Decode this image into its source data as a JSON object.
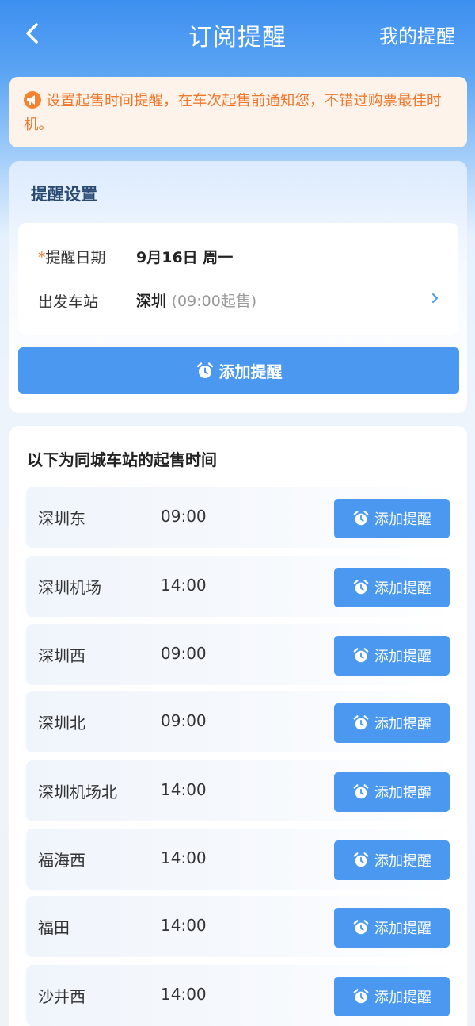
{
  "header": {
    "title": "订阅提醒",
    "right_link": "我的提醒",
    "back_icon": "chevron-left-icon"
  },
  "notice": {
    "icon": "megaphone-icon",
    "text": "设置起售时间提醒，在车次起售前通知您，不错过购票最佳时机。"
  },
  "settings": {
    "title": "提醒设置",
    "date_label": "提醒日期",
    "required_mark": "*",
    "date_value": "9月16日 周一",
    "station_label": "出发车站",
    "station_value": "深圳",
    "station_sale_time": "(09:00起售)",
    "add_button": "添加提醒"
  },
  "stations": {
    "title": "以下为同城车站的起售时间",
    "button_label": "添加提醒",
    "items": [
      {
        "name": "深圳东",
        "time": "09:00"
      },
      {
        "name": "深圳机场",
        "time": "14:00"
      },
      {
        "name": "深圳西",
        "time": "09:00"
      },
      {
        "name": "深圳北",
        "time": "09:00"
      },
      {
        "name": "深圳机场北",
        "time": "14:00"
      },
      {
        "name": "福海西",
        "time": "14:00"
      },
      {
        "name": "福田",
        "time": "14:00"
      },
      {
        "name": "沙井西",
        "time": "14:00"
      }
    ]
  },
  "colors": {
    "primary": "#4a98ef",
    "header": "#3d8ff0",
    "notice_text": "#f0772b",
    "notice_bg": "#fdf3ea"
  }
}
